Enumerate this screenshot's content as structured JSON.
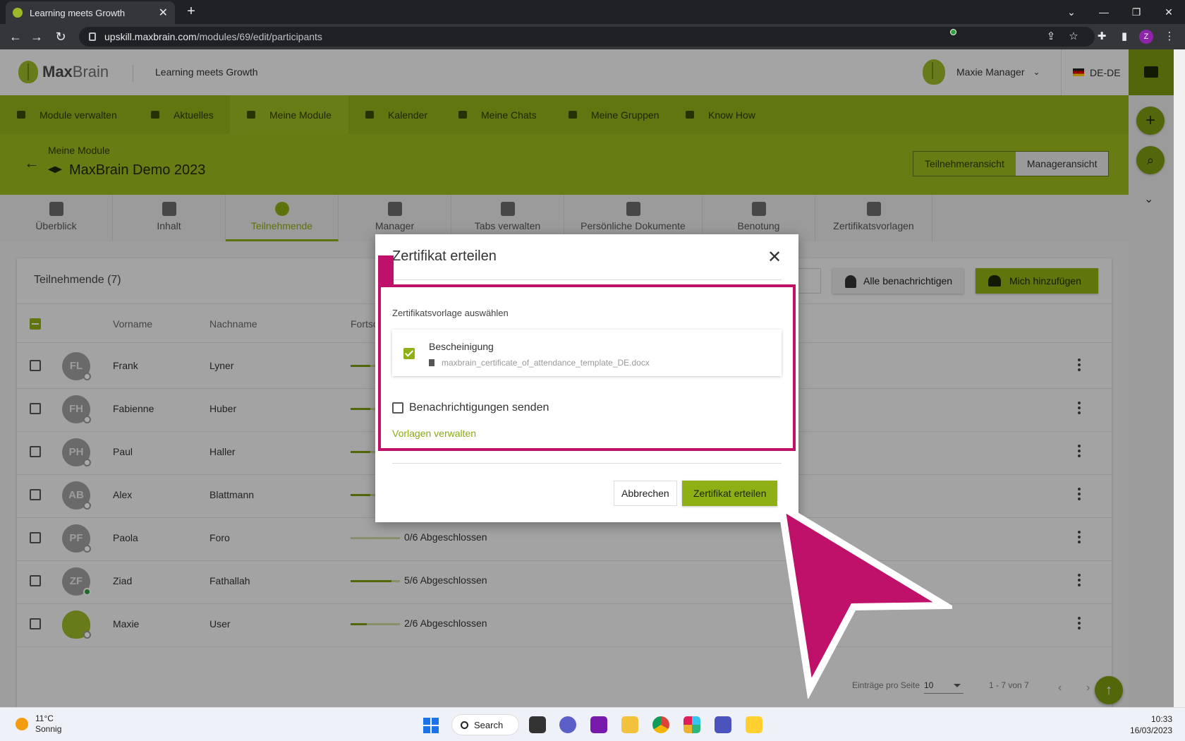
{
  "browser": {
    "tab_title": "Learning meets Growth",
    "url_host": "upskill.maxbrain.com",
    "url_path": "/modules/69/edit/participants",
    "profile_initial": "Z"
  },
  "header": {
    "logo_max": "Max",
    "logo_brain": "Brain",
    "tagline": "Learning meets Growth",
    "user_name": "Maxie Manager",
    "language": "DE-DE"
  },
  "nav": {
    "items": [
      {
        "label": "Module verwalten"
      },
      {
        "label": "Aktuelles"
      },
      {
        "label": "Meine Module"
      },
      {
        "label": "Kalender"
      },
      {
        "label": "Meine Chats"
      },
      {
        "label": "Meine Gruppen"
      },
      {
        "label": "Know How"
      }
    ]
  },
  "module": {
    "breadcrumb": "Meine Module",
    "title": "MaxBrain Demo 2023",
    "view_participant": "Teilnehmeransicht",
    "view_manager": "Manageransicht"
  },
  "subtabs": [
    {
      "label": "Überblick"
    },
    {
      "label": "Inhalt"
    },
    {
      "label": "Teilnehmende"
    },
    {
      "label": "Manager"
    },
    {
      "label": "Tabs verwalten"
    },
    {
      "label": "Persönliche Dokumente"
    },
    {
      "label": "Benotung"
    },
    {
      "label": "Zertifikatsvorlagen"
    }
  ],
  "participants": {
    "title": "Teilnehmende (7)",
    "notify_all": "Alle benachrichtigen",
    "add_me": "Mich hinzufügen",
    "columns": {
      "first": "Vorname",
      "last": "Nachname",
      "progress": "Fortsc"
    },
    "rows": [
      {
        "initials": "FL",
        "first": "Frank",
        "last": "Lyner",
        "progress_text": "",
        "progress": 0.4,
        "online": false
      },
      {
        "initials": "FH",
        "first": "Fabienne",
        "last": "Huber",
        "progress_text": "",
        "progress": 0.4,
        "online": false
      },
      {
        "initials": "PH",
        "first": "Paul",
        "last": "Haller",
        "progress_text": "",
        "progress": 0.4,
        "online": false
      },
      {
        "initials": "AB",
        "first": "Alex",
        "last": "Blattmann",
        "progress_text": "",
        "progress": 0.4,
        "online": false
      },
      {
        "initials": "PF",
        "first": "Paola",
        "last": "Foro",
        "progress_text": "0/6 Abgeschlossen",
        "progress": 0.0,
        "online": false
      },
      {
        "initials": "ZF",
        "first": "Ziad",
        "last": "Fathallah",
        "progress_text": "5/6 Abgeschlossen",
        "progress": 0.833,
        "online": true
      },
      {
        "initials": "",
        "first": "Maxie",
        "last": "User",
        "progress_text": "2/6 Abgeschlossen",
        "progress": 0.333,
        "online": false
      }
    ],
    "per_page_label": "Einträge pro Seite",
    "per_page_value": "10",
    "range_text": "1 - 7 von 7"
  },
  "modal": {
    "title": "Zertifikat erteilen",
    "select_label": "Zertifikatsvorlage auswählen",
    "template_name": "Bescheinigung",
    "template_file": "maxbrain_certificate_of_attendance_template_DE.docx",
    "send_notifications": "Benachrichtigungen senden",
    "manage_link": "Vorlagen verwalten",
    "cancel": "Abbrechen",
    "confirm": "Zertifikat erteilen"
  },
  "taskbar": {
    "temp": "11°C",
    "weather": "Sonnig",
    "search": "Search",
    "time": "10:33",
    "date": "16/03/2023"
  },
  "colors": {
    "brand_green": "#90b018",
    "highlight_magenta": "#c0116a"
  }
}
